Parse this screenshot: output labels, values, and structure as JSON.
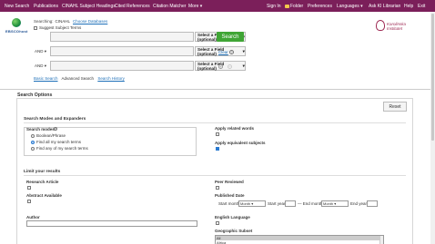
{
  "topnav": {
    "left": [
      "New Search",
      "Publications",
      "CINAHL Subject Headings",
      "Cited References",
      "Citation Matcher",
      "More"
    ],
    "more_caret": "▾",
    "right": [
      "Sign In",
      "Folder",
      "Preferences",
      "Languages",
      "Ask KI Librarian",
      "Help",
      "Exit"
    ],
    "languages_caret": "▾",
    "bg": "#7b1f5a"
  },
  "logo": {
    "text": "EBSCOhost"
  },
  "searching": {
    "label": "Searching:",
    "db": "CINAHL",
    "choose": "Choose Databases"
  },
  "suggest": {
    "label": "Suggest Subject Terms"
  },
  "rows": [
    {
      "bool": "",
      "field": "Select a Field (optional)"
    },
    {
      "bool": "AND",
      "field": "Select a Field (optional)"
    },
    {
      "bool": "AND",
      "field": "Select a Field (optional)"
    }
  ],
  "search_button": "Search",
  "clear": "Clear",
  "help_glyph": "?",
  "tabs": {
    "basic": "Basic Search",
    "advanced": "Advanced Search",
    "history": "Search History"
  },
  "institution_logo": {
    "line1": "Karolinska",
    "line2": "Institutet"
  },
  "search_options": {
    "title": "Search Options",
    "reset": "Reset",
    "modes_expanders": "Search Modes and Expanders",
    "search_modes": "Search modes",
    "modes": [
      {
        "label": "Boolean/Phrase",
        "checked": false
      },
      {
        "label": "Find all my search terms",
        "checked": true
      },
      {
        "label": "Find any of my search terms",
        "checked": false
      }
    ],
    "apply_related": "Apply related words",
    "apply_equivalent": "Apply equivalent subjects",
    "limit_title": "Limit your results",
    "research_article": "Research Article",
    "abstract_available": "Abstract Available",
    "author": "Author",
    "peer_reviewed": "Peer Reviewed",
    "published_date": "Published Date",
    "start_month": "Start month",
    "start_month_value": "Month",
    "start_year": "Start year",
    "end_month": "End month",
    "end_month_value": "Month",
    "end_year": "End year",
    "english_language": "English Language",
    "geographic_subset": "Geographic Subset",
    "geo_options": [
      "All",
      "Africa"
    ]
  }
}
